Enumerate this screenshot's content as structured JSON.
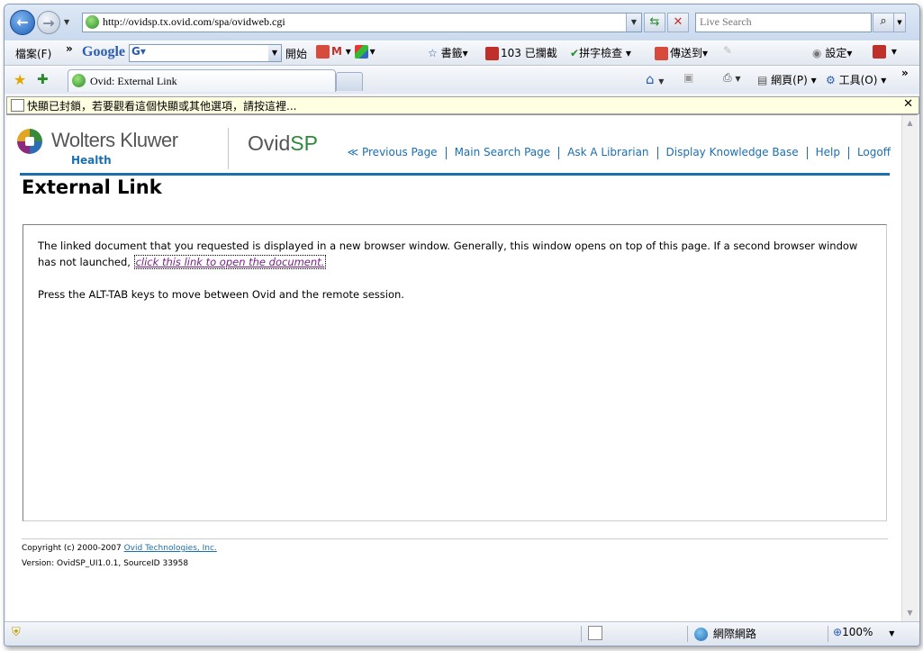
{
  "browser": {
    "url": "http://ovidsp.tx.ovid.com/spa/ovidweb.cgi",
    "search_placeholder": "Live Search",
    "menu": {
      "file": "檔案(F)",
      "chevron": "»",
      "google": "Google",
      "start": "開始",
      "bookmarks": "書籤▾",
      "blocked": "103 已攔截",
      "spellcheck": "拼字檢查",
      "sendto": "傳送到▾",
      "settings": "設定▾"
    },
    "tab_title": "Ovid: External Link",
    "command_bar": {
      "page": "網頁(P)",
      "tools": "工具(O)"
    },
    "infobar_text": "快顯已封鎖，若要觀看這個快顯或其他選項，請按這裡..."
  },
  "page": {
    "logo_brand": "Wolters Kluwer",
    "logo_health": "Health",
    "product_name_a": "Ovid",
    "product_name_b": "SP",
    "nav": {
      "previous": "≪ Previous Page",
      "main_search": "Main Search Page",
      "librarian": "Ask A Librarian",
      "knowledge": "Display Knowledge Base",
      "help": "Help",
      "logoff": "Logoff"
    },
    "title": "External Link",
    "body_text_1": "The linked document that you requested is displayed in a new browser window. Generally, this window opens on top of this page. If a second browser window has not launched, ",
    "body_link": "click this link to open the document.",
    "body_text_2": "Press the ALT-TAB keys to move between Ovid and the remote session.",
    "copyright_prefix": "Copyright (c) 2000-2007 ",
    "copyright_link": "Ovid Technologies, Inc.",
    "version": "Version: OvidSP_UI1.0.1, SourceID 33958"
  },
  "status": {
    "zone": "網際網路",
    "zoom": "100%"
  },
  "colors": {
    "brand_blue": "#1b6faf",
    "link_visited": "#7a1f8a",
    "ovid_green": "#2c8a3a"
  }
}
